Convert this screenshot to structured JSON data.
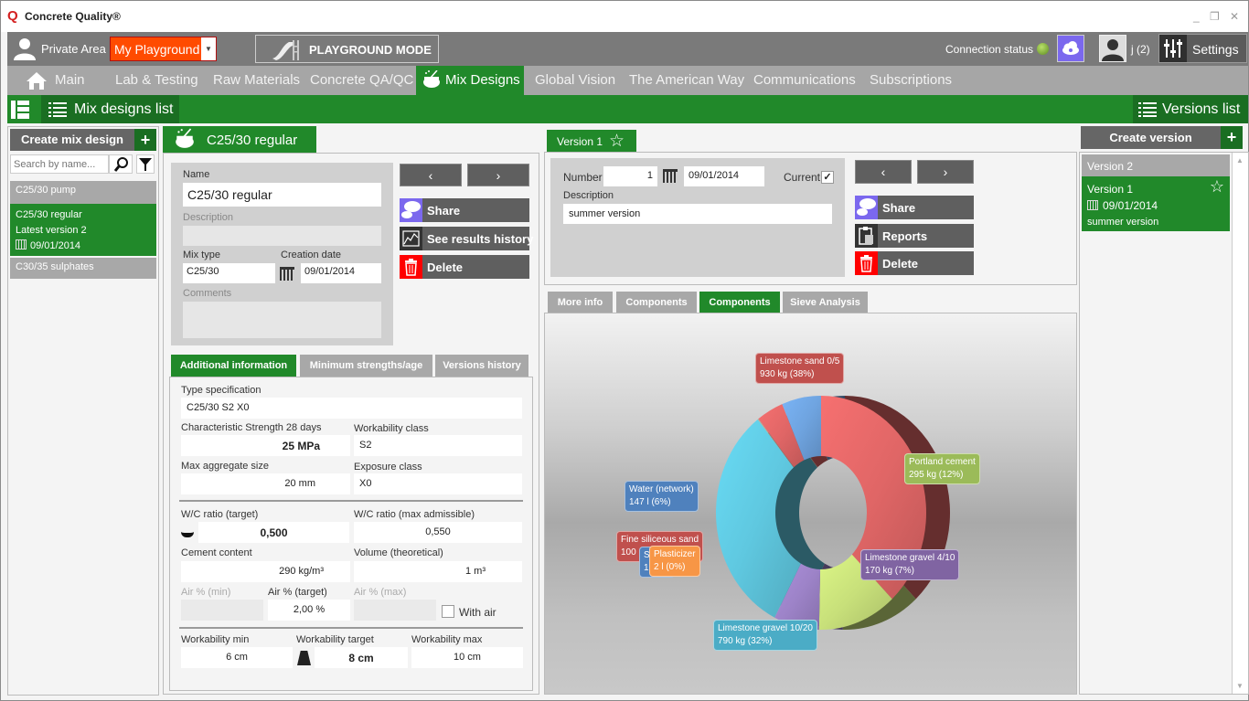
{
  "app": {
    "logo": "Q",
    "title": "Concrete Quality®",
    "window_buttons": [
      "_",
      "❐",
      "✕"
    ]
  },
  "topbar": {
    "private_area": "Private Area",
    "playground_select": "My Playground",
    "playground_mode": "PLAYGROUND MODE",
    "connection_status": "Connection status",
    "user": "j (2)",
    "settings": "Settings",
    "colors": {
      "playground": "#ff4b00",
      "cloud": "#7b68ee"
    }
  },
  "nav": {
    "items": [
      {
        "label": "Main"
      },
      {
        "label": "Lab & Testing"
      },
      {
        "label": "Raw Materials"
      },
      {
        "label": "Concrete QA/QC"
      },
      {
        "label": "Mix Designs",
        "active": true
      },
      {
        "label": "Global Vision"
      },
      {
        "label": "The American Way"
      },
      {
        "label": "Communications"
      },
      {
        "label": "Subscriptions"
      }
    ]
  },
  "greenbar": {
    "mix_designs_list": "Mix designs list",
    "versions_list": "Versions list"
  },
  "left": {
    "create_label": "Create mix design",
    "plus": "+",
    "search_placeholder": "Search by name...",
    "items": [
      {
        "name": "C25/30 pump"
      },
      {
        "name": "C25/30 regular",
        "sub": "Latest version 2",
        "date": "09/01/2014",
        "selected": true
      },
      {
        "name": "C30/35 sulphates"
      }
    ]
  },
  "mix": {
    "tab_title": "C25/30 regular",
    "name_label": "Name",
    "name_value": "C25/30 regular",
    "description_label": "Description",
    "description_value": "",
    "mix_type_label": "Mix type",
    "mix_type_value": "C25/30",
    "creation_date_label": "Creation date",
    "creation_date_value": "09/01/2014",
    "comments_label": "Comments",
    "prev": "‹",
    "next": "›",
    "share": "Share",
    "results_history": "See results history",
    "delete": "Delete"
  },
  "subtabs": [
    "Additional information",
    "Minimum strengths/age",
    "Versions history"
  ],
  "addinfo": {
    "type_spec_label": "Type specification",
    "type_spec": "C25/30 S2 X0",
    "char_strength_label": "Characteristic Strength 28 days",
    "char_strength": "25 MPa",
    "workability_class_label": "Workability class",
    "workability_class": "S2",
    "max_agg_label": "Max aggregate size",
    "max_agg": "20 mm",
    "exposure_label": "Exposure class",
    "exposure": "X0",
    "wc_target_label": "W/C ratio (target)",
    "wc_target": "0,500",
    "wc_max_label": "W/C ratio (max admissible)",
    "wc_max": "0,550",
    "cement_label": "Cement content",
    "cement": "290 kg/m³",
    "volume_label": "Volume (theoretical)",
    "volume": "1 m³",
    "air_min_label": "Air % (min)",
    "air_min": "",
    "air_target_label": "Air % (target)",
    "air_target": "2,00 %",
    "air_max_label": "Air % (max)",
    "air_max": "",
    "with_air_label": "With air",
    "with_air": false,
    "work_min_label": "Workability min",
    "work_min": "6 cm",
    "work_target_label": "Workability target",
    "work_target": "8 cm",
    "work_max_label": "Workability max",
    "work_max": "10 cm"
  },
  "version": {
    "tab_title": "Version 1",
    "number_label": "Number",
    "number": "1",
    "date": "09/01/2014",
    "current_label": "Current",
    "current": true,
    "description_label": "Description",
    "description": "summer version",
    "prev": "‹",
    "next": "›",
    "share": "Share",
    "reports": "Reports",
    "delete": "Delete"
  },
  "chart_tabs": [
    "More info",
    "Components",
    "Components",
    "Sieve Analysis"
  ],
  "versions": {
    "create_label": "Create version",
    "plus": "+",
    "items": [
      {
        "title": "Version 2"
      },
      {
        "title": "Version 1",
        "date": "09/01/2014",
        "description": "summer version",
        "selected": true
      }
    ]
  },
  "chart_data": {
    "type": "pie",
    "style": "3d-donut",
    "title": "",
    "slices": [
      {
        "label": "Limestone sand 0/5",
        "value": 930,
        "unit": "kg",
        "percent": 38,
        "color": "#e06666"
      },
      {
        "label": "Portland cement",
        "value": 295,
        "unit": "kg",
        "percent": 12,
        "color": "#c8e07a"
      },
      {
        "label": "Limestone gravel 4/10",
        "value": 170,
        "unit": "kg",
        "percent": 7,
        "color": "#9d83c8"
      },
      {
        "label": "Limestone gravel 10/20",
        "value": 790,
        "unit": "kg",
        "percent": 32,
        "color": "#5fc8e0"
      },
      {
        "label": "Plasticizer",
        "value": 2,
        "unit": "l",
        "percent": 0,
        "color": "#f4934a"
      },
      {
        "label": "Su…",
        "value": 1,
        "unit": "",
        "percent": 0,
        "color": "#4f81bd"
      },
      {
        "label": "Fine siliceous sand",
        "value": 100,
        "unit": "",
        "percent": 4,
        "color": "#e06666"
      },
      {
        "label": "Water (network)",
        "value": 147,
        "unit": "l",
        "percent": 6,
        "color": "#6fa4e0"
      }
    ],
    "label_colors": {
      "Limestone sand 0/5": "#c0504d",
      "Portland cement": "#9bbb59",
      "Limestone gravel 4/10": "#8064a2",
      "Limestone gravel 10/20": "#4bacc6",
      "Plasticizer": "#f79646",
      "Su…": "#4f81bd",
      "Fine siliceous sand": "#c0504d",
      "Water (network)": "#4f81bd"
    }
  }
}
